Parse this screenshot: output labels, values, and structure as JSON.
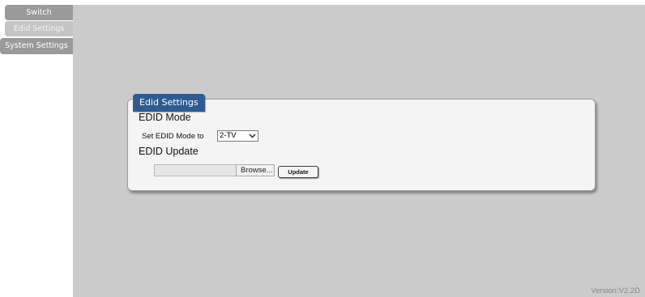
{
  "sidebar": {
    "items": [
      {
        "label": "Switch"
      },
      {
        "label": "Edid Settings"
      },
      {
        "label": "System Settings"
      }
    ]
  },
  "panel": {
    "title": "Edid Settings",
    "edid_mode": {
      "heading": "EDID Mode",
      "label": "Set EDID Mode to",
      "selected": "2-TV"
    },
    "edid_update": {
      "heading": "EDID Update",
      "browse_label": "Browse...",
      "update_label": "Update"
    }
  },
  "footer": {
    "version": "Version:V2.2D"
  },
  "colors": {
    "tab_dark": "#9a9a9a",
    "tab_active": "#c4c4c4",
    "main_bg": "#cbcbcb",
    "panel_title_bg": "#2f5b93"
  },
  "icons": {
    "select_arrow": "chevron-down-icon"
  }
}
